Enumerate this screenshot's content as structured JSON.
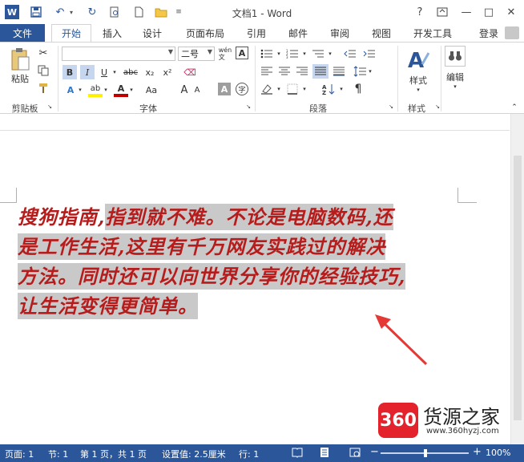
{
  "titlebar": {
    "title": "文档1 - Word",
    "help": "?",
    "minimize": "—",
    "restore": "□",
    "close": "✕"
  },
  "tabs": {
    "file": "文件",
    "items": [
      "开始",
      "插入",
      "设计",
      "页面布局",
      "引用",
      "邮件",
      "审阅",
      "视图",
      "开发工具"
    ],
    "active": "开始",
    "user": "登录"
  },
  "ribbon": {
    "clipboard": {
      "paste": "粘贴",
      "label": "剪贴板"
    },
    "font": {
      "font_name_value": "",
      "font_size_value": "二号",
      "wen_label": "wén\n文",
      "label": "字体",
      "bold": "B",
      "italic": "I",
      "underline": "U",
      "strike": "abc",
      "subscript": "x₂",
      "superscript": "x²",
      "grow": "A",
      "shrink": "A",
      "case": "Aa",
      "clear_format": "A",
      "shading": "A",
      "enclose": "字"
    },
    "paragraph": {
      "label": "段落"
    },
    "styles": {
      "button": "样式",
      "label": "样式"
    },
    "editing": {
      "button": "编辑"
    }
  },
  "document": {
    "lines": [
      {
        "plain": "搜狗指南,",
        "selected": "指到就不难。不论是电脑数码,还"
      },
      {
        "plain": "",
        "selected": "是工作生活,这里有千万网友实践过的解决"
      },
      {
        "plain": "",
        "selected": "方法。同时还可以向世界分享你的经验技巧,"
      },
      {
        "plain": "",
        "selected": "让生活变得更简单。"
      }
    ],
    "text_color": "#b71c1c",
    "selection_color": "#c9c9c9"
  },
  "watermark": {
    "badge": "360",
    "title": "货源之家",
    "url": "www.360hyzj.com"
  },
  "statusbar": {
    "page": "页面: 1",
    "section": "节: 1",
    "page_of": "第 1 页，共 1 页",
    "setting": "设置值: 2.5厘米",
    "row": "行: 1",
    "zoom": "100%",
    "zoom_level": 1.0
  },
  "colors": {
    "accent": "#2b579a",
    "status_bar": "#2b579a",
    "arrow": "#e53935"
  }
}
